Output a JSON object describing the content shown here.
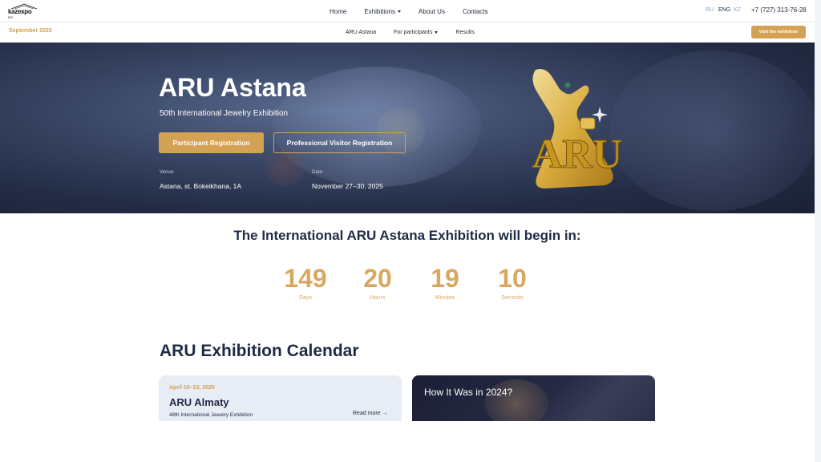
{
  "header": {
    "logo_text": "kazexpo",
    "logo_sub": "IEC",
    "nav": [
      {
        "label": "Home",
        "dropdown": false
      },
      {
        "label": "Exhibitions",
        "dropdown": true
      },
      {
        "label": "About Us",
        "dropdown": false
      },
      {
        "label": "Contacts",
        "dropdown": false
      }
    ],
    "languages": [
      "RU",
      "ENG",
      "KZ"
    ],
    "phone": "+7 (727) 313-76-28"
  },
  "subheader": {
    "date": "September 2025",
    "nav": [
      {
        "label": "ARU Astana",
        "dropdown": false
      },
      {
        "label": "For participants",
        "dropdown": true
      },
      {
        "label": "Results",
        "dropdown": false
      }
    ],
    "visit_button": "Visit the exhibition"
  },
  "hero": {
    "title": "ARU Astana",
    "subtitle": "50th International Jewelry Exhibition",
    "primary_button": "Participant Registration",
    "secondary_button": "Professional Visitor Registration",
    "venue_label": "Venue:",
    "venue_value": "Astana, st. Bokeikhana, 1A",
    "date_label": "Date:",
    "date_value": "November 27–30, 2025",
    "logo_letters": "ARU"
  },
  "countdown": {
    "title": "The International ARU Astana Exhibition will begin in:",
    "items": [
      {
        "value": "149",
        "label": "Days"
      },
      {
        "value": "20",
        "label": "Hours"
      },
      {
        "value": "19",
        "label": "Minutes"
      },
      {
        "value": "10",
        "label": "Seconds"
      }
    ]
  },
  "calendar": {
    "title": "ARU Exhibition Calendar",
    "cards": [
      {
        "date": "April 10–13, 2025",
        "title": "ARU Almaty",
        "subtitle": "48th International Jewelry Exhibition",
        "more": "Read more →"
      },
      {
        "title": "How It Was in 2024?"
      }
    ]
  },
  "colors": {
    "accent": "#d4a254",
    "dark": "#1f2a44",
    "hero_bg": "#2a334f"
  }
}
